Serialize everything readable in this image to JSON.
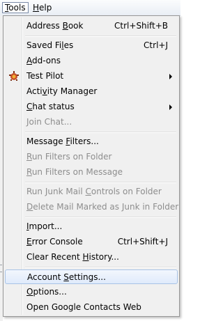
{
  "menubar": {
    "tools": {
      "mnemonic": "T",
      "rest": "ools"
    },
    "help": {
      "mnemonic": "H",
      "rest": "elp"
    }
  },
  "menu": {
    "address_book": {
      "pre": "Address ",
      "m": "B",
      "post": "ook",
      "shortcut": "Ctrl+Shift+B"
    },
    "saved_files": {
      "pre": "Saved Fi",
      "m": "l",
      "post": "es",
      "shortcut": "Ctrl+J"
    },
    "addons": {
      "pre": "",
      "m": "A",
      "post": "dd-ons"
    },
    "test_pilot": {
      "pre": "Test Pilot",
      "m": "",
      "post": ""
    },
    "activity_manager": {
      "pre": "Acti",
      "m": "v",
      "post": "ity Manager"
    },
    "chat_status": {
      "pre": "",
      "m": "C",
      "post": "hat status"
    },
    "join_chat": {
      "pre": "Join Chat",
      "m": "",
      "post": "..."
    },
    "message_filters": {
      "pre": "Message ",
      "m": "F",
      "post": "ilters..."
    },
    "run_filters_folder": {
      "pre": "",
      "m": "R",
      "post": "un Filters on Folder"
    },
    "run_filters_message": {
      "pre": "",
      "m": "R",
      "post": "un Filters on Message"
    },
    "run_junk": {
      "pre": "Run Junk Mail ",
      "m": "C",
      "post": "ontrols on Folder"
    },
    "delete_junk": {
      "pre": "",
      "m": "D",
      "post": "elete Mail Marked as Junk in Folder"
    },
    "import": {
      "pre": "",
      "m": "I",
      "post": "mport..."
    },
    "error_console": {
      "pre": "",
      "m": "E",
      "post": "rror Console",
      "shortcut": "Ctrl+Shift+J"
    },
    "clear_history": {
      "pre": "Clear Recent ",
      "m": "H",
      "post": "istory..."
    },
    "account_settings": {
      "pre": "Account ",
      "m": "S",
      "post": "ettings..."
    },
    "options": {
      "pre": "",
      "m": "O",
      "post": "ptions..."
    },
    "google_contacts": {
      "pre": "Open Google Contacts Web",
      "m": "",
      "post": ""
    }
  },
  "colors": {
    "menu_bg": "#f0f0f0",
    "disabled_text": "#8d8d8d",
    "highlight_border": "#a8c3e6"
  },
  "icons": {
    "test_pilot": "test-pilot-icon",
    "submenu": "submenu-arrow-icon"
  }
}
